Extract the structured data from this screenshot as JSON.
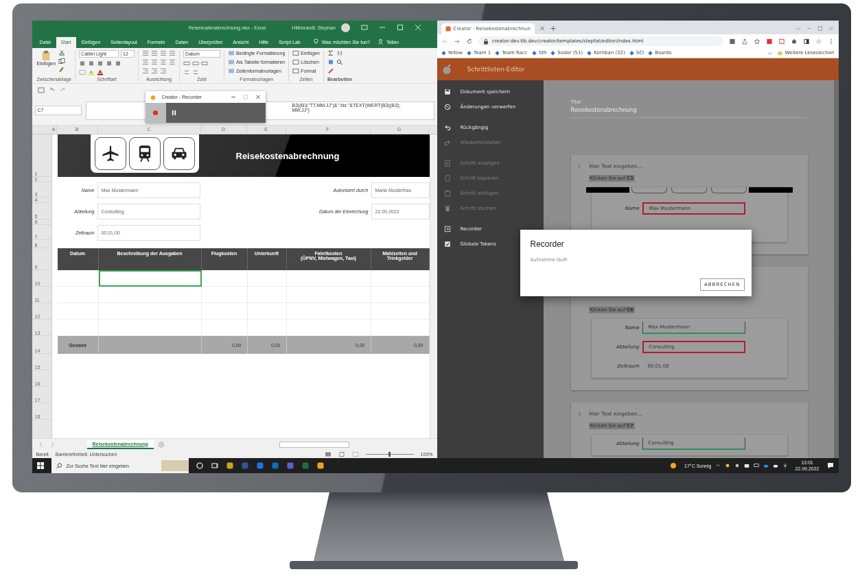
{
  "excel": {
    "title": "Reisekostenabrechnung.xlsx - Excel",
    "user": "Hillebrandt, Stephan",
    "tabs": [
      {
        "label": "Datei",
        "selected": false
      },
      {
        "label": "Start",
        "selected": true
      },
      {
        "label": "Einfügen",
        "selected": false
      },
      {
        "label": "Seitenlayout",
        "selected": false
      },
      {
        "label": "Formeln",
        "selected": false
      },
      {
        "label": "Daten",
        "selected": false
      },
      {
        "label": "Überprüfen",
        "selected": false
      },
      {
        "label": "Ansicht",
        "selected": false
      },
      {
        "label": "Hilfe",
        "selected": false
      },
      {
        "label": "Script Lab",
        "selected": false
      }
    ],
    "tell_me": "Was möchten Sie tun?",
    "share": "Teilen",
    "ribbon": {
      "paste": "Einfügen",
      "font": "Calibri Light",
      "size": "12",
      "number_format": "Datum",
      "styles": [
        "Bedingte Formatierung",
        "Als Tabelle formatieren",
        "Zellenformatvorlagen"
      ],
      "cells": [
        "Einfügen",
        "Löschen",
        "Format"
      ],
      "groups": [
        "Zwischenablage",
        "Schriftart",
        "Ausrichtung",
        "Zahl",
        "Formatvorlagen",
        "Zellen",
        "Bearbeiten"
      ]
    },
    "name_box": "C7",
    "formula": [
      "B3)(B3;\"TT.MM.JJ\")&\" bis \"&TEXT(WERT(B3)(B3);",
      "MM.JJ\")"
    ],
    "columns": [
      "A",
      "B",
      "C",
      "D",
      "E",
      "F",
      "G"
    ],
    "rows": [
      "1",
      "2",
      "3",
      "4",
      "5",
      "6",
      "7",
      "8",
      "9",
      "10",
      "11",
      "12",
      "13",
      "14",
      "15",
      "16",
      "17",
      "18"
    ],
    "sheet": {
      "title": "Reisekostenabrechnung",
      "left_fields": [
        {
          "label": "Name",
          "value": "Max Mustermann"
        },
        {
          "label": "Abteilung",
          "value": "Consulting"
        },
        {
          "label": "Zeitraum",
          "value": "00.01.00"
        }
      ],
      "right_fields": [
        {
          "label": "Autorisiert durch",
          "value": "Maria Musterfrau"
        },
        {
          "label": "Datum der Einreichung",
          "value": "22.09.2022"
        }
      ],
      "headers": [
        "Datum",
        "Beschreibung der Ausgaben",
        "Flugkosten",
        "Unterkunft",
        "Fahrtkosten\n(ÖPNV, Mietwagen, Taxi)",
        "Mahlzeiten und\nTrinkgelder"
      ],
      "entry_rows": [
        {
          "cells": [
            {
              "selected": false
            },
            {
              "selected": true
            },
            {
              "selected": false
            },
            {
              "selected": false
            },
            {
              "selected": false
            },
            {
              "selected": false
            }
          ]
        },
        {
          "cells": [
            {
              "selected": false
            },
            {
              "selected": false
            },
            {
              "selected": false
            },
            {
              "selected": false
            },
            {
              "selected": false
            },
            {
              "selected": false
            }
          ]
        },
        {
          "cells": [
            {
              "selected": false
            },
            {
              "selected": false
            },
            {
              "selected": false
            },
            {
              "selected": false
            },
            {
              "selected": false
            },
            {
              "selected": false
            }
          ]
        },
        {
          "cells": [
            {
              "selected": false
            },
            {
              "selected": false
            },
            {
              "selected": false
            },
            {
              "selected": false
            },
            {
              "selected": false
            },
            {
              "selected": false
            }
          ]
        }
      ],
      "total": {
        "label": "Gesamt",
        "values": [
          "0,00",
          "0,00",
          "0,00",
          "0,00"
        ]
      }
    },
    "sheet_tab": "Reisekostenabrechnung",
    "status": {
      "ready": "Bereit",
      "accessibility": "Barrierefreiheit: Untersuchen",
      "zoom": "100%",
      "zoom_slider": {
        "level": 0.5
      }
    }
  },
  "recorder": {
    "title": "Creator - Recorder"
  },
  "browser": {
    "tab_title": "Creator - Reisekostenabrechnun",
    "url": "creator-dev.tlb.dev/creator/templates/stepfat/editor/index.html",
    "bookmarks": [
      "Yellow",
      "Team 1",
      "Team Racc",
      "5th",
      "Sodor (51)",
      "Kornban (32)",
      "SCI",
      "Boards"
    ],
    "more_bookmarks": "Weitere Lesezeichen"
  },
  "editor": {
    "app_title": "Schrittlisten-Editor",
    "sidebar": [
      {
        "label": "Dokument speichern",
        "disabled": false
      },
      {
        "label": "Änderungen verwerfen",
        "disabled": false
      },
      {
        "label": "Rückgängig",
        "disabled": false
      },
      {
        "label": "Wiederherstellen",
        "disabled": true
      },
      {
        "label": "Schritt anzeigen",
        "disabled": true
      },
      {
        "label": "Schritt kopieren",
        "disabled": true
      },
      {
        "label": "Schritt einfügen",
        "disabled": true
      },
      {
        "label": "Schritt löschen",
        "disabled": true
      },
      {
        "label": "Recorder",
        "disabled": false
      },
      {
        "label": "Globale Tokens",
        "disabled": false
      }
    ],
    "title_label": "Titel",
    "title_value": "Reisekostenabrechnung",
    "steps": [
      {
        "number": "1",
        "text": "Hier Text eingeben...",
        "instruction": "Klicken Sie auf **C3**",
        "banner": true,
        "fields": [
          {
            "label": "Name",
            "value": "Max Mustermann",
            "kind": "target"
          }
        ]
      },
      {
        "instruction": "Klicken Sie auf **C6**",
        "banner": false,
        "fields": [
          {
            "label": "Name",
            "value": "Max Mustermann",
            "kind": "done"
          },
          {
            "label": "Abteilung",
            "value": "Consulting",
            "kind": "target"
          },
          {
            "label": "Zeitraum",
            "value": "00.01.00",
            "kind": "plain"
          }
        ]
      },
      {
        "number": "3",
        "text": "Hier Text eingeben...",
        "instruction": "Klicken Sie auf **C7**",
        "banner": false,
        "fields": [
          {
            "label": "Abteilung",
            "value": "Consulting",
            "kind": "done"
          }
        ]
      }
    ]
  },
  "dialog": {
    "title": "Recorder",
    "text": "Aufnahme läuft",
    "button": "ABBRECHEN"
  },
  "taskbar": {
    "search_placeholder": "Zur Suche Text hier eingeben",
    "weather": "17°C Sonnig",
    "time": "13:01",
    "date": "22.09.2022"
  }
}
